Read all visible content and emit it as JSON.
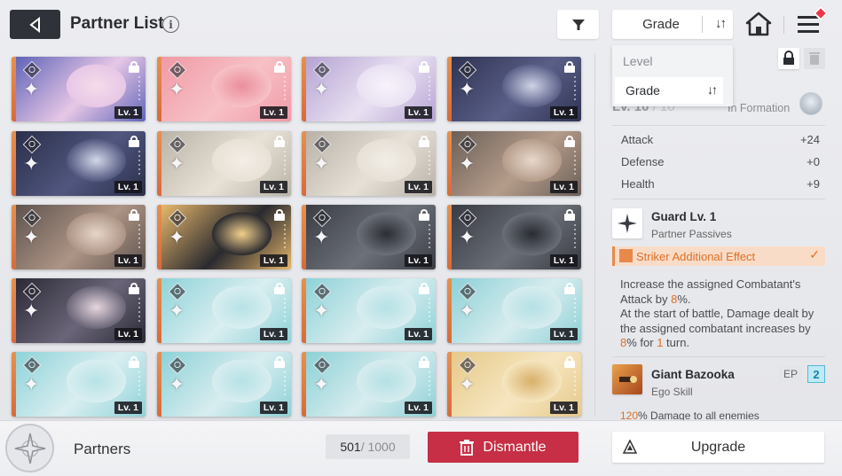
{
  "header": {
    "title": "Partner List",
    "info_icon": "i",
    "sort_label": "Grade",
    "sort_arrows": "↓↑"
  },
  "sort_dropdown": {
    "options": [
      {
        "label": "Level",
        "selected": false
      },
      {
        "label": "Grade",
        "selected": true,
        "arrows": "↓↑"
      }
    ]
  },
  "cards": [
    {
      "level": "Lv. 1",
      "icon": "lightning-icon",
      "art": [
        "#5f64b8",
        "#e7c7e6",
        "#f4dcea"
      ]
    },
    {
      "level": "Lv. 1",
      "icon": "swords-icon",
      "art": [
        "#f09aa6",
        "#f7c1c6",
        "#eb8f9c"
      ]
    },
    {
      "level": "Lv. 1",
      "icon": "swords-icon",
      "art": [
        "#b5a3d3",
        "#e9e1f2",
        "#f7f3fb"
      ]
    },
    {
      "level": "Lv. 1",
      "icon": "shield-icon",
      "art": [
        "#2f3352",
        "#5a5f88",
        "#cfd3e6"
      ]
    },
    {
      "level": "Lv. 1",
      "icon": "shield-icon",
      "art": [
        "#2a2f4a",
        "#50567e",
        "#d3d7e9"
      ]
    },
    {
      "level": "Lv. 1",
      "icon": "swords-icon",
      "art": [
        "#b9b3a8",
        "#e8e1d6",
        "#f3eee7"
      ]
    },
    {
      "level": "Lv. 1",
      "icon": "swords-icon",
      "art": [
        "#b7b1a8",
        "#e6e0d6",
        "#f2ede6"
      ]
    },
    {
      "level": "Lv. 1",
      "icon": "swords-icon",
      "art": [
        "#6b5f58",
        "#b59c8a",
        "#e8d8cc"
      ]
    },
    {
      "level": "Lv. 1",
      "icon": "swords-icon",
      "art": [
        "#5e534e",
        "#ad9485",
        "#e6d6ca"
      ]
    },
    {
      "level": "Lv. 1",
      "icon": "target-icon",
      "art": [
        "#e8b86c",
        "#2a2a2f",
        "#f2cf8a"
      ]
    },
    {
      "level": "Lv. 1",
      "icon": "target-icon",
      "art": [
        "#3a3d44",
        "#6c7079",
        "#2b2e34"
      ]
    },
    {
      "level": "Lv. 1",
      "icon": "target-icon",
      "art": [
        "#383b42",
        "#6a6e77",
        "#292c32"
      ]
    },
    {
      "level": "Lv. 1",
      "icon": "lightning-icon",
      "art": [
        "#2b2a36",
        "#6a6578",
        "#e6d6de"
      ]
    },
    {
      "level": "Lv. 1",
      "icon": "circle-icon",
      "art": [
        "#8ed3d9",
        "#d9eef0",
        "#b7e3e7"
      ]
    },
    {
      "level": "Lv. 1",
      "icon": "circle-icon",
      "art": [
        "#8dd2d8",
        "#d8edef",
        "#b5e2e6"
      ]
    },
    {
      "level": "Lv. 1",
      "icon": "circle-icon",
      "art": [
        "#8cd1d7",
        "#d7ecee",
        "#b4e1e5"
      ]
    },
    {
      "level": "Lv. 1",
      "icon": "circle-icon",
      "art": [
        "#8ed3d9",
        "#d9eef0",
        "#b7e3e7"
      ]
    },
    {
      "level": "Lv. 1",
      "icon": "circle-icon",
      "art": [
        "#8dd2d8",
        "#d8edef",
        "#b5e2e6"
      ]
    },
    {
      "level": "Lv. 1",
      "icon": "circle-icon",
      "art": [
        "#8cd1d7",
        "#d7ecee",
        "#b4e1e5"
      ]
    },
    {
      "level": "Lv. 1",
      "icon": "circle-icon",
      "art": [
        "#e6c98a",
        "#f6e6c0",
        "#d8b06a"
      ]
    }
  ],
  "detail": {
    "level_text": "Lv. 10",
    "level_max": "/ 10",
    "in_formation": "In Formation",
    "stats": [
      {
        "label": "Attack",
        "value": "+24"
      },
      {
        "label": "Defense",
        "value": "+0"
      },
      {
        "label": "Health",
        "value": "+9"
      }
    ],
    "passive": {
      "name": "Guard Lv. 1",
      "type": "Partner Passives",
      "tag": "Striker Additional Effect",
      "desc_1": "Increase the assigned Combatant's Attack by ",
      "desc_1_hl": "8",
      "desc_1_end": "%.",
      "desc_2": "At the start of battle, Damage dealt by the assigned combatant increases by ",
      "desc_2_hl": "8",
      "desc_2_mid": "% for ",
      "desc_2_hl2": "1",
      "desc_2_end": " turn."
    },
    "ego": {
      "name": "Giant Bazooka",
      "type": "Ego Skill",
      "ep_label": "EP",
      "ep_value": "2",
      "dmg_hl": "120",
      "dmg_text": "% Damage to all enemies"
    }
  },
  "footer": {
    "partners_label": "Partners",
    "count_current": "501",
    "count_max": " / 1000",
    "dismantle_label": "Dismantle",
    "upgrade_label": "Upgrade"
  },
  "colors": {
    "accent_red": "#c62f45",
    "accent_orange": "#e06f26",
    "ep_blue": "#1a82aa"
  }
}
